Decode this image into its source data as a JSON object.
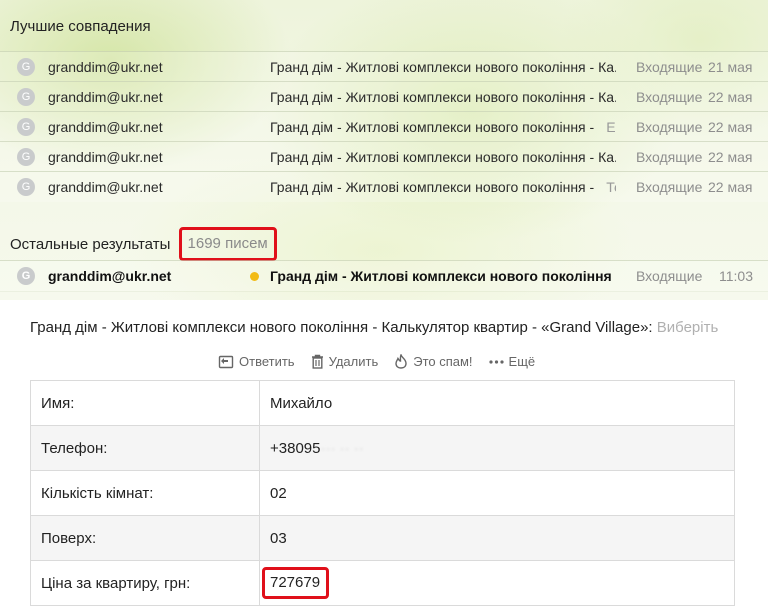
{
  "best_matches": {
    "title": "Лучшие совпадения",
    "rows": [
      {
        "avatar": "G",
        "sender": "granddim@ukr.net",
        "subject": "Гранд дім - Житлові комплекси нового покоління - Ка...",
        "snippet": "",
        "folder": "Входящие",
        "date": "21 мая"
      },
      {
        "avatar": "G",
        "sender": "granddim@ukr.net",
        "subject": "Гранд дім - Житлові комплекси нового покоління - Ка...",
        "snippet": "",
        "folder": "Входящие",
        "date": "22 мая"
      },
      {
        "avatar": "G",
        "sender": "granddim@ukr.net",
        "subject": "Гранд дім - Житлові комплекси нового покоління -",
        "snippet": "E-...",
        "folder": "Входящие",
        "date": "22 мая"
      },
      {
        "avatar": "G",
        "sender": "granddim@ukr.net",
        "subject": "Гранд дім - Житлові комплекси нового покоління - Ка...",
        "snippet": "",
        "folder": "Входящие",
        "date": "22 мая"
      },
      {
        "avatar": "G",
        "sender": "granddim@ukr.net",
        "subject": "Гранд дім - Житлові комплекси нового покоління -",
        "snippet": "Те...",
        "folder": "Входящие",
        "date": "22 мая"
      }
    ]
  },
  "other_results": {
    "title": "Остальные результаты",
    "count": "1699 писем",
    "rows": [
      {
        "avatar": "G",
        "sender": "granddim@ukr.net",
        "subject": "Гранд дім - Житлові комплекси нового покоління -...",
        "folder": "Входящие",
        "date": "11:03",
        "unread": true
      }
    ]
  },
  "message": {
    "subject": "Гранд дім - Житлові комплекси нового покоління - Калькулятор квартир - «Grand Village»:",
    "subject_tail": " Виберіть",
    "toolbar": {
      "reply": "Ответить",
      "delete": "Удалить",
      "spam": "Это спам!",
      "more": "Ещё"
    },
    "fields": [
      {
        "label": "Имя:",
        "value": "Михайло"
      },
      {
        "label": "Телефон:",
        "value": "+38095",
        "value_hidden": "··· ·· ··"
      },
      {
        "label": "Кількість кімнат:",
        "value": "02"
      },
      {
        "label": "Поверх:",
        "value": "03"
      },
      {
        "label": "Ціна за квартиру, грн:",
        "value": "727679"
      }
    ]
  },
  "colors": {
    "highlight": "#e0101a",
    "unread_dot": "#f2bb14",
    "avatar": "#c9cbcc"
  }
}
